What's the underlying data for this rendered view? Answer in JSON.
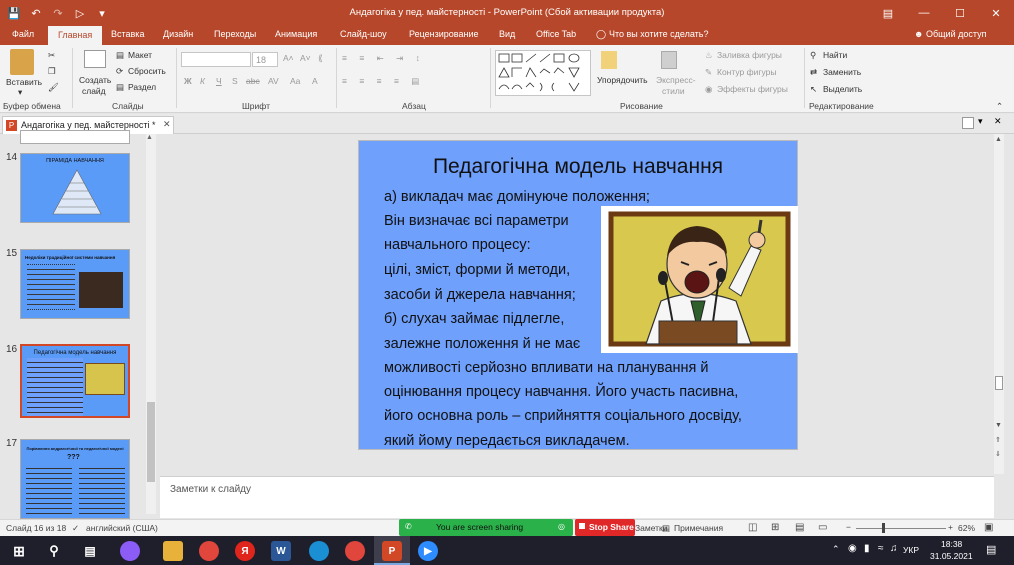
{
  "window": {
    "title": "Андагогіка у пед. майстерності - PowerPoint (Сбой активации продукта)",
    "qat_icons": [
      "save-icon",
      "undo-icon",
      "redo-icon",
      "customize-icon"
    ]
  },
  "tabs": [
    "Файл",
    "Главная",
    "Вставка",
    "Дизайн",
    "Переходы",
    "Анимация",
    "Слайд-шоу",
    "Рецензирование",
    "Вид",
    "Office Tab"
  ],
  "tell_me": "Что вы хотите сделать?",
  "share_label": "Общий доступ",
  "ribbon": {
    "clipboard": {
      "paste": "Вставить",
      "label": "Буфер обмена"
    },
    "slides": {
      "new_slide_1": "Создать",
      "new_slide_2": "слайд",
      "layout": "Макет",
      "reset": "Сбросить",
      "section": "Раздел",
      "label": "Слайды"
    },
    "font": {
      "size": "18",
      "bold": "Ж",
      "italic": "К",
      "underline": "Ч",
      "strike": "S",
      "shadow": "abc",
      "spacing": "AV",
      "case": "Aa",
      "color": "A",
      "label": "Шрифт"
    },
    "paragraph": {
      "label": "Абзац"
    },
    "drawing": {
      "arrange": "Упорядочить",
      "quick_styles_1": "Экспресс-",
      "quick_styles_2": "стили",
      "fill": "Заливка фигуры",
      "outline": "Контур фигуры",
      "effects": "Эффекты фигуры",
      "label": "Рисование"
    },
    "editing": {
      "find": "Найти",
      "replace": "Заменить",
      "select": "Выделить",
      "label": "Редактирование"
    }
  },
  "doc_tab": "Андагогіка у пед. майстерності *",
  "thumbnails": [
    {
      "num": "14",
      "title": "ПІРАМІДА НАВЧАННЯ"
    },
    {
      "num": "15",
      "title": "Недоліки традиційної системи навчання"
    },
    {
      "num": "16",
      "title": "Педагогічна модель навчання"
    },
    {
      "num": "17",
      "title": "Порівняння андрагогічної та педагогічної моделі",
      "mark": "???"
    }
  ],
  "slide": {
    "title": "Педагогічна модель навчання",
    "lines": [
      "а) викладач має домінуюче положення;",
      "Він визначає всі параметри",
      "навчального процесу:",
      "цілі, зміст, форми й методи,",
      "засоби й джерела навчання;",
      "б) слухач займає підлегле,",
      "залежне положення й не має",
      " можливості серйозно впливати на планування й",
      "оцінювання процесу навчання. Його участь пасивна,",
      "його основна роль – сприйняття соціального досвіду,",
      " який йому передається викладачем."
    ]
  },
  "notes_placeholder": "Заметки к слайду",
  "status": {
    "slide_info": "Слайд 16 из 18",
    "language": "английский (США)",
    "notes": "Заметки",
    "comments": "Примечания",
    "zoom": "62%"
  },
  "share_bar": {
    "text": "You are screen sharing",
    "stop": "Stop Share"
  },
  "taskbar": {
    "lang": "УКР",
    "time": "18:38",
    "date": "31.05.2021"
  }
}
